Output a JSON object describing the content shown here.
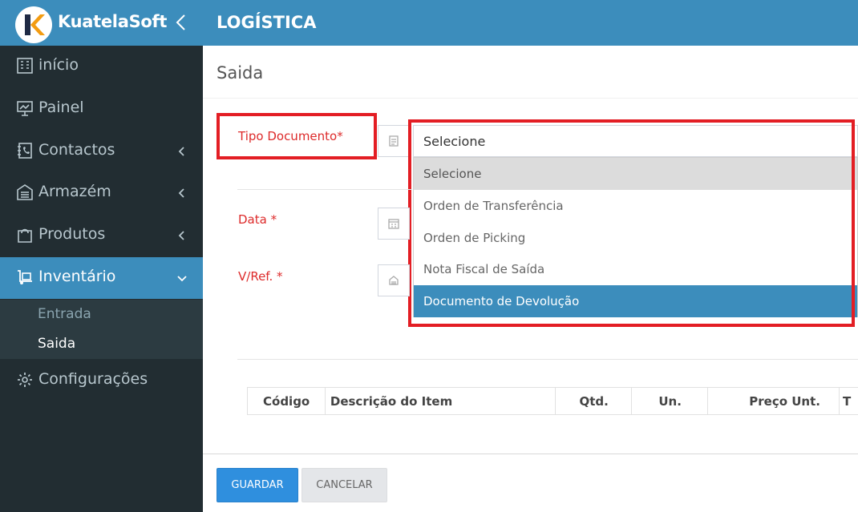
{
  "app": {
    "brand": "KuatelaSoft",
    "logo_letter": "K"
  },
  "header": {
    "title": "LOGÍSTICA"
  },
  "sidebar": {
    "items": [
      {
        "label": "início",
        "icon": "building-icon"
      },
      {
        "label": "Painel",
        "icon": "presentation-icon"
      },
      {
        "label": "Contactos",
        "icon": "phone-book-icon"
      },
      {
        "label": "Armazém",
        "icon": "warehouse-icon"
      },
      {
        "label": "Produtos",
        "icon": "shopping-bag-icon"
      },
      {
        "label": "Inventário",
        "icon": "dolly-icon"
      },
      {
        "label": "Configurações",
        "icon": "gear-icon"
      }
    ],
    "submenu": [
      {
        "label": "Entrada"
      },
      {
        "label": "Saida"
      }
    ]
  },
  "page": {
    "title": "Saida"
  },
  "form": {
    "tipo_documento": {
      "label": "Tipo Documento*",
      "value": "Selecione",
      "options": [
        "Selecione",
        "Orden de Transferência",
        "Orden de Picking",
        "Nota Fiscal de Saída",
        "Documento de Devolução"
      ]
    },
    "data": {
      "label": "Data *"
    },
    "vref": {
      "label": "V/Ref. *"
    }
  },
  "table": {
    "columns": [
      "Código",
      "Descrição do Item",
      "Qtd.",
      "Un.",
      "Preço Unt.",
      "T"
    ]
  },
  "buttons": {
    "save": "GUARDAR",
    "cancel": "CANCELAR"
  },
  "colors": {
    "header": "#3c8dbc",
    "sidebar": "#222d32",
    "highlight": "#e31e24",
    "selected": "#3c8dbc"
  }
}
